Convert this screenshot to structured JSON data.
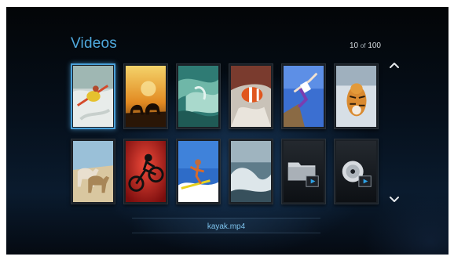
{
  "header": {
    "title": "Videos",
    "counter_current": "10",
    "counter_of": "of",
    "counter_total": "100"
  },
  "navigation": {
    "scroll_up_icon": "chevron-up-icon",
    "scroll_down_icon": "chevron-down-icon"
  },
  "grid": {
    "selected_index": 0,
    "items": [
      {
        "kind": "video",
        "subject": "kayaker"
      },
      {
        "kind": "video",
        "subject": "elephants at sunset"
      },
      {
        "kind": "video",
        "subject": "wave"
      },
      {
        "kind": "video",
        "subject": "clownfish"
      },
      {
        "kind": "video",
        "subject": "jumper"
      },
      {
        "kind": "video",
        "subject": "tiger"
      },
      {
        "kind": "video",
        "subject": "horses"
      },
      {
        "kind": "video",
        "subject": "bmx rider"
      },
      {
        "kind": "video",
        "subject": "surfer"
      },
      {
        "kind": "video",
        "subject": "ocean spray"
      },
      {
        "kind": "folder",
        "subject": "folder-icon"
      },
      {
        "kind": "disc",
        "subject": "disc-icon"
      }
    ]
  },
  "footer": {
    "filename": "kayak.mp4"
  },
  "colors": {
    "accent": "#4fa8dc",
    "filename": "#7ec4ee",
    "selection_border": "#4aa0d8"
  }
}
